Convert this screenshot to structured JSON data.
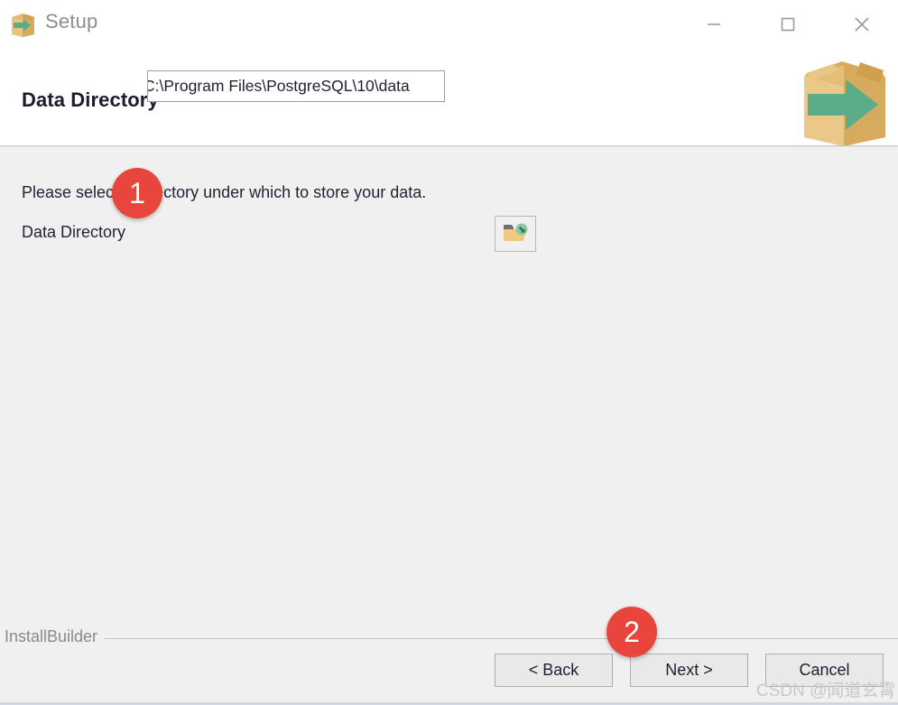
{
  "window": {
    "title": "Setup",
    "icon": "setup-box-arrow-icon",
    "controls": {
      "minimize": "minimize-icon",
      "maximize": "maximize-icon",
      "close": "close-icon"
    }
  },
  "header": {
    "page_title": "Data Directory",
    "art_icon": "box-with-green-arrow-icon"
  },
  "main": {
    "intro_text": "Please select a directory under which to store your data.",
    "field_label": "Data Directory",
    "directory_value": "C:\\Program Files\\PostgreSQL\\10\\data",
    "directory_placeholder": "C:\\Program Files\\PostgreSQL\\10\\data",
    "browse_icon": "folder-open-browse-icon"
  },
  "footer": {
    "brand": "InstallBuilder",
    "back_label": "< Back",
    "next_label": "Next >",
    "cancel_label": "Cancel"
  },
  "annotations": [
    {
      "id": "1",
      "label": "1"
    },
    {
      "id": "2",
      "label": "2"
    }
  ],
  "watermark": "CSDN @闻道玄霄",
  "colors": {
    "accent_green": "#5BAD8A",
    "box_tan": "#E2B96D",
    "badge_red": "#E8463C",
    "body_bg": "#F0F0F0",
    "title_text": "#8D8D8D"
  }
}
